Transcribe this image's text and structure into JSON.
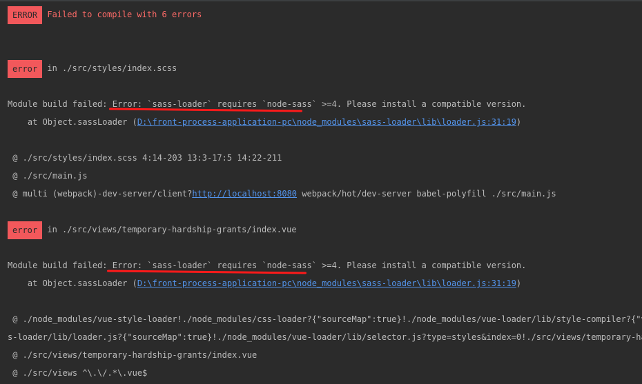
{
  "error_header": {
    "badge": "ERROR",
    "message": "Failed to compile with 6 errors"
  },
  "error1": {
    "badge": "error",
    "location": "in ./src/styles/index.scss",
    "module_prefix": "Module build failed: ",
    "module_error": "Error: `sass-loader` requires `node-sass` ",
    "module_suffix": ">=4. Please install a compatible version.",
    "at_prefix": "    at Object.sassLoader (",
    "at_link": "D:\\front-process-application-pc\\node_modules\\sass-loader\\lib\\loader.js:31:19",
    "at_suffix": ")",
    "trace1": " @ ./src/styles/index.scss 4:14-203 13:3-17:5 14:22-211",
    "trace2": " @ ./src/main.js",
    "trace3_prefix": " @ multi (webpack)-dev-server/client?",
    "trace3_link": "http://localhost:8080",
    "trace3_suffix": " webpack/hot/dev-server babel-polyfill ./src/main.js"
  },
  "error2": {
    "badge": "error",
    "location": "in ./src/views/temporary-hardship-grants/index.vue",
    "module_prefix": "Module build failed: ",
    "module_error": "Error: `sass-loader` requires `node-sass` ",
    "module_suffix": ">=4. Please install a compatible version.",
    "at_prefix": "    at Object.sassLoader (",
    "at_link": "D:\\front-process-application-pc\\node_modules\\sass-loader\\lib\\loader.js:31:19",
    "at_suffix": ")",
    "trace1": " @ ./node_modules/vue-style-loader!./node_modules/css-loader?{\"sourceMap\":true}!./node_modules/vue-loader/lib/style-compiler?{\"vue\":true,",
    "trace1_wrap": "s-loader/lib/loader.js?{\"sourceMap\":true}!./node_modules/vue-loader/lib/selector.js?type=styles&index=0!./src/views/temporary-hardship-grants",
    "trace2": " @ ./src/views/temporary-hardship-grants/index.vue",
    "trace3": " @ ./src/views ^\\.\\/.*\\.vue$"
  },
  "colors": {
    "background": "#2b2b2b",
    "text": "#bbbbbb",
    "badge": "#f2585b",
    "error_text": "#ff6b68",
    "link": "#5394ec",
    "annotation": "#ff1a1a"
  }
}
